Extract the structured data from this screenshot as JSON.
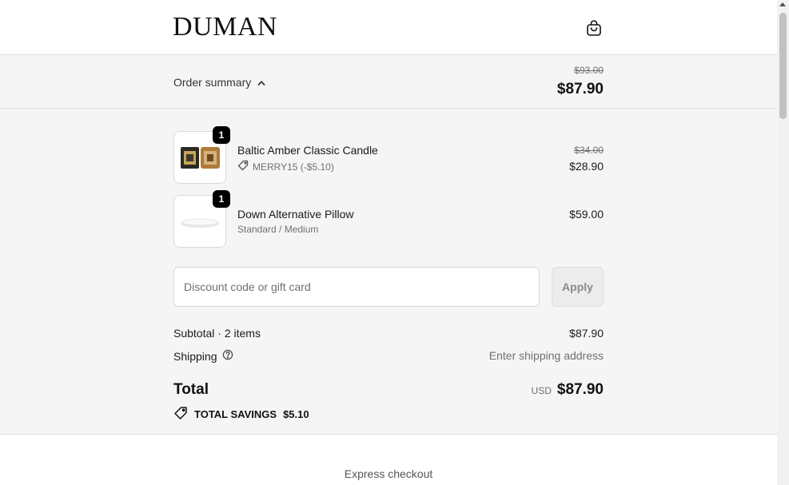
{
  "header": {
    "logo": "DUMAN",
    "bag_icon": "shopping-bag-icon"
  },
  "summary_bar": {
    "toggle_label": "Order summary",
    "toggle_icon": "chevron-up-icon",
    "original_total": "$93.00",
    "total": "$87.90"
  },
  "items": [
    {
      "name": "Baltic Amber Classic Candle",
      "quantity": "1",
      "discount_code": "MERRY15 (-$5.10)",
      "original_price": "$34.00",
      "price": "$28.90"
    },
    {
      "name": "Down Alternative Pillow",
      "quantity": "1",
      "variant": "Standard / Medium",
      "price": "$59.00"
    }
  ],
  "discount": {
    "placeholder": "Discount code or gift card",
    "apply_label": "Apply"
  },
  "totals": {
    "subtotal_label": "Subtotal · 2 items",
    "subtotal_value": "$87.90",
    "shipping_label": "Shipping",
    "shipping_value": "Enter shipping address",
    "total_label": "Total",
    "currency": "USD",
    "total_value": "$87.90",
    "savings_label": "TOTAL SAVINGS",
    "savings_value": "$5.10"
  },
  "express_checkout": "Express checkout",
  "colors": {
    "panel_bg": "#f5f5f5",
    "border": "#dedede",
    "muted_text": "#707070",
    "badge_bg": "#000000"
  }
}
